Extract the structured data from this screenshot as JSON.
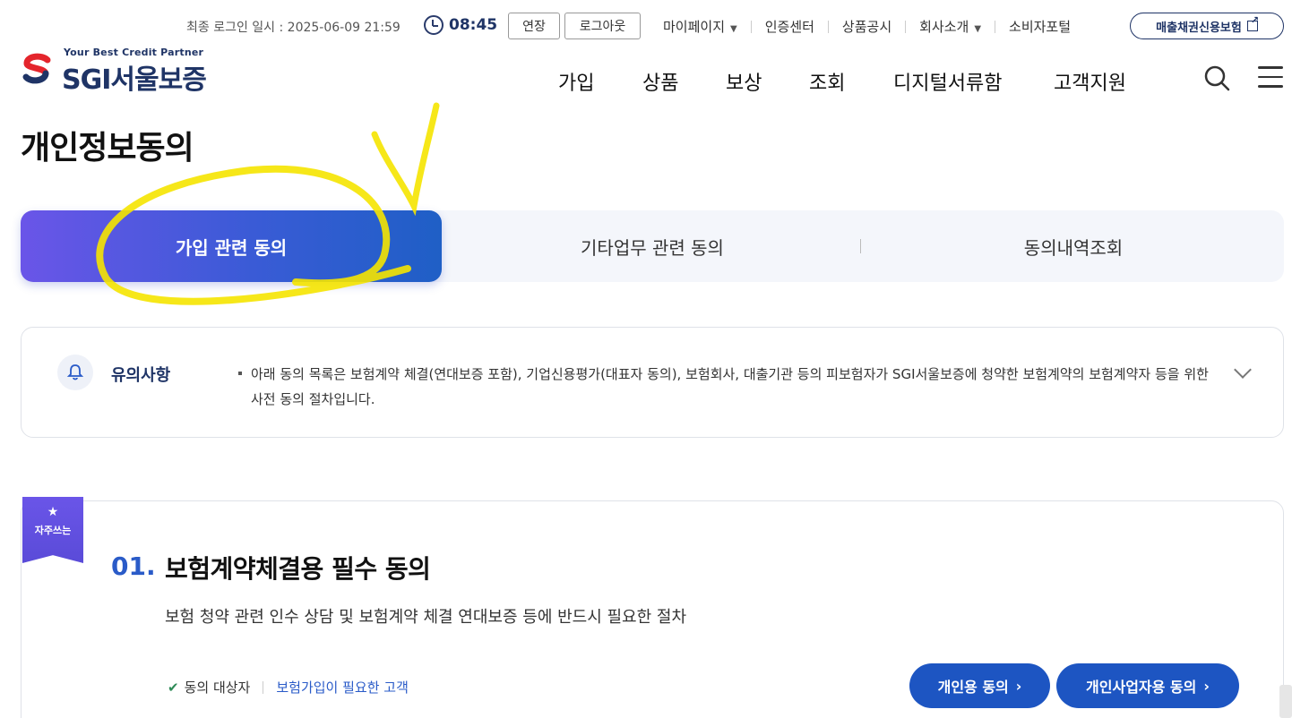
{
  "utility": {
    "last_login": "최종 로그인 일시 : 2025-06-09 21:59",
    "session_time": "08:45",
    "extend_label": "연장",
    "logout_label": "로그아웃",
    "links": [
      {
        "label": "마이페이지",
        "dropdown": true
      },
      {
        "label": "인증센터",
        "dropdown": false
      },
      {
        "label": "상품공시",
        "dropdown": false
      },
      {
        "label": "회사소개",
        "dropdown": true
      },
      {
        "label": "소비자포털",
        "dropdown": false
      }
    ],
    "external_pill": "매출채권신용보험"
  },
  "brand": {
    "tagline": "Your Best Credit Partner",
    "name": "SGI서울보증",
    "colors": {
      "navy": "#1f3466",
      "red": "#e4252c",
      "accent": "#1d55c2",
      "purple": "#6a55e8"
    }
  },
  "nav": [
    "가입",
    "상품",
    "보상",
    "조회",
    "디지털서류함",
    "고객지원"
  ],
  "page_title": "개인정보동의",
  "tabs": [
    {
      "label": "가입 관련 동의",
      "active": true
    },
    {
      "label": "기타업무 관련 동의",
      "active": false
    },
    {
      "label": "동의내역조회",
      "active": false
    }
  ],
  "notice": {
    "label": "유의사항",
    "text": "아래 동의 목록은 보험계약 체결(연대보증 포함), 기업신용평가(대표자 동의), 보험회사, 대출기관 등의 피보험자가 SGI서울보증에 청약한 보험계약의 보험계약자 등을 위한 사전 동의 절차입니다."
  },
  "card": {
    "badge": "자주쓰는",
    "number": "01.",
    "title": "보험계약체결용 필수 동의",
    "description": "보험 청약 관련 인수 상담 및 보험계약 체결 연대보증 등에 반드시 필요한 절차",
    "target_label": "동의 대상자",
    "target_value": "보험가입이 필요한 고객",
    "buttons": [
      "개인용 동의",
      "개인사업자용 동의"
    ]
  }
}
